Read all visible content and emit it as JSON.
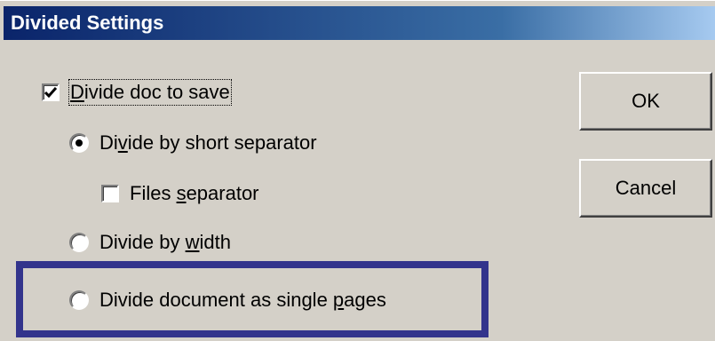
{
  "dialog": {
    "title": "Divided Settings"
  },
  "options": {
    "divide_doc": {
      "pre": "",
      "ul": "D",
      "post": "ivide doc to save",
      "checked": true
    },
    "short_separator": {
      "pre": "Di",
      "ul": "v",
      "post": "ide by short separator",
      "selected": true
    },
    "files_separator": {
      "pre": "Files ",
      "ul": "s",
      "post": "eparator",
      "checked": false
    },
    "by_width": {
      "pre": "Divide by ",
      "ul": "w",
      "post": "idth",
      "selected": false
    },
    "single_pages": {
      "pre": "Divide document as single ",
      "ul": "p",
      "post": "ages",
      "selected": false
    }
  },
  "buttons": {
    "ok_label": "OK",
    "cancel_label": "Cancel"
  },
  "colors": {
    "highlight_border": "#33348c",
    "dialog_face": "#d4d0c8",
    "title_start": "#0a246a"
  }
}
